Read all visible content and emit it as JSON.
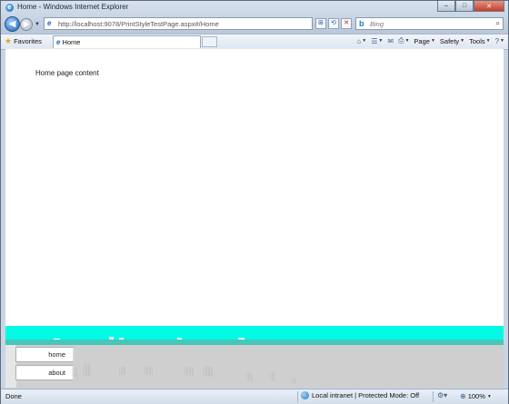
{
  "window": {
    "title": "Home - Windows Internet Explorer",
    "minimize": "–",
    "maximize": "□",
    "close": "✕"
  },
  "nav": {
    "back": "◀",
    "forward": "▶",
    "dropdown": "▼",
    "address": "http://localhost:9078/PrintStyleTestPage.aspx#/Home",
    "compat": "⊞",
    "refresh": "⟲",
    "stop": "✕",
    "search_placeholder": "Bing",
    "search_glyph": "⌕"
  },
  "favorites_bar": {
    "favorites_label": "Favorites",
    "tab_label": "Home",
    "commands": [
      {
        "icon": "⌂",
        "label": ""
      },
      {
        "icon": "☰",
        "label": ""
      },
      {
        "icon": "✉",
        "label": ""
      },
      {
        "icon": "⎙",
        "label": ""
      },
      {
        "icon": "",
        "label": "Page"
      },
      {
        "icon": "",
        "label": "Safety"
      },
      {
        "icon": "",
        "label": "Tools"
      },
      {
        "icon": "?",
        "label": ""
      }
    ]
  },
  "content": {
    "home_text": "Home page content",
    "menu": [
      {
        "label": "home"
      },
      {
        "label": "about"
      }
    ]
  },
  "status": {
    "left": "Done",
    "zone": "Local intranet | Protected Mode: Off",
    "zoom": "100%"
  }
}
